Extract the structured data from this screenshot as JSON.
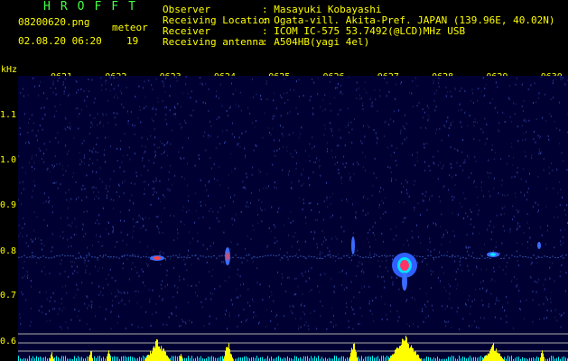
{
  "header": {
    "app_title": "HROFFT",
    "filename": "08200620.png",
    "meteor_label": "meteor",
    "datetime": "02.08.20 06:20",
    "meteor_count": "19",
    "observer_label": "Observer",
    "observer_value": ": Masayuki Kobayashi",
    "location_label": "Receiving Location",
    "location_value": ": Ogata-vill. Akita-Pref. JAPAN (139.96E, 40.02N)",
    "receiver_label": "Receiver",
    "receiver_value": ": ICOM IC-575 53.7492(@LCD)MHz USB",
    "antenna_label": "Receiving antenna",
    "antenna_value": ": A504HB(yagi 4el)"
  },
  "axes": {
    "y_unit": "kHz",
    "y_ticks": [
      "1.1",
      "1.0",
      "0.9",
      "0.8",
      "0.7",
      "0.6"
    ],
    "x_ticks": [
      "0621",
      "0622",
      "0623",
      "0624",
      "0625",
      "0626",
      "0627",
      "0628",
      "0629",
      "0630"
    ]
  },
  "colors": {
    "background": "#000000",
    "spectrogram_bg": "#000033",
    "text": "#ffff00",
    "title": "#44ff44",
    "echo": "#ff3333",
    "trace": "#00ffff"
  }
}
